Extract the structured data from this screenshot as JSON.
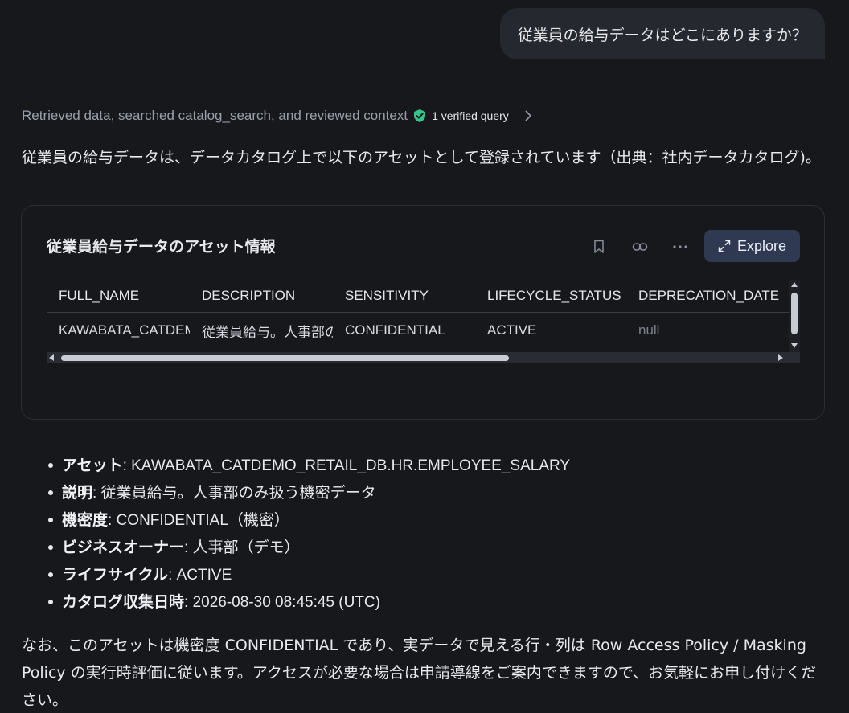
{
  "user_message": "従業員の給与データはどこにありますか？",
  "steps": {
    "summary": "Retrieved data, searched catalog_search, and reviewed context",
    "verified_label": "1 verified query"
  },
  "intro_text": "従業員の給与データは、データカタログ上で以下のアセットとして登録されています（出典：社内データカタログ)。",
  "card": {
    "title": "従業員給与データのアセット情報",
    "explore_label": "Explore",
    "table": {
      "columns": [
        "FULL_NAME",
        "DESCRIPTION",
        "SENSITIVITY",
        "LIFECYCLE_STATUS",
        "DEPRECATION_DATE"
      ],
      "rows": [
        [
          "KAWABATA_CATDEMO_RETAIL_DB.HR.EMPLOYEE_SALARY",
          "従業員給与。人事部のみ扱う機密データ",
          "CONFIDENTIAL",
          "ACTIVE",
          "null"
        ]
      ]
    }
  },
  "details": [
    {
      "label": "アセット",
      "value": ": KAWABATA_CATDEMO_RETAIL_DB.HR.EMPLOYEE_SALARY"
    },
    {
      "label": "説明",
      "value": ": 従業員給与。人事部のみ扱う機密データ"
    },
    {
      "label": "機密度",
      "value": ": CONFIDENTIAL（機密）"
    },
    {
      "label": "ビジネスオーナー",
      "value": ": 人事部（デモ）"
    },
    {
      "label": "ライフサイクル",
      "value": ": ACTIVE"
    },
    {
      "label": "カタログ収集日時",
      "value": ": 2026-08-30 08:45:45 (UTC)"
    }
  ],
  "note": "なお、このアセットは機密度 CONFIDENTIAL であり、実データで見える行・列は Row Access Policy / Masking Policy の実行時評価に従います。アクセスが必要な場合は申請導線をご案内できますので、お気軽にお申し付けください。",
  "colors": {
    "background": "#17181c",
    "bubble": "#26282f",
    "verified_badge": "#35c58a",
    "explore_button": "#2f3a52"
  }
}
